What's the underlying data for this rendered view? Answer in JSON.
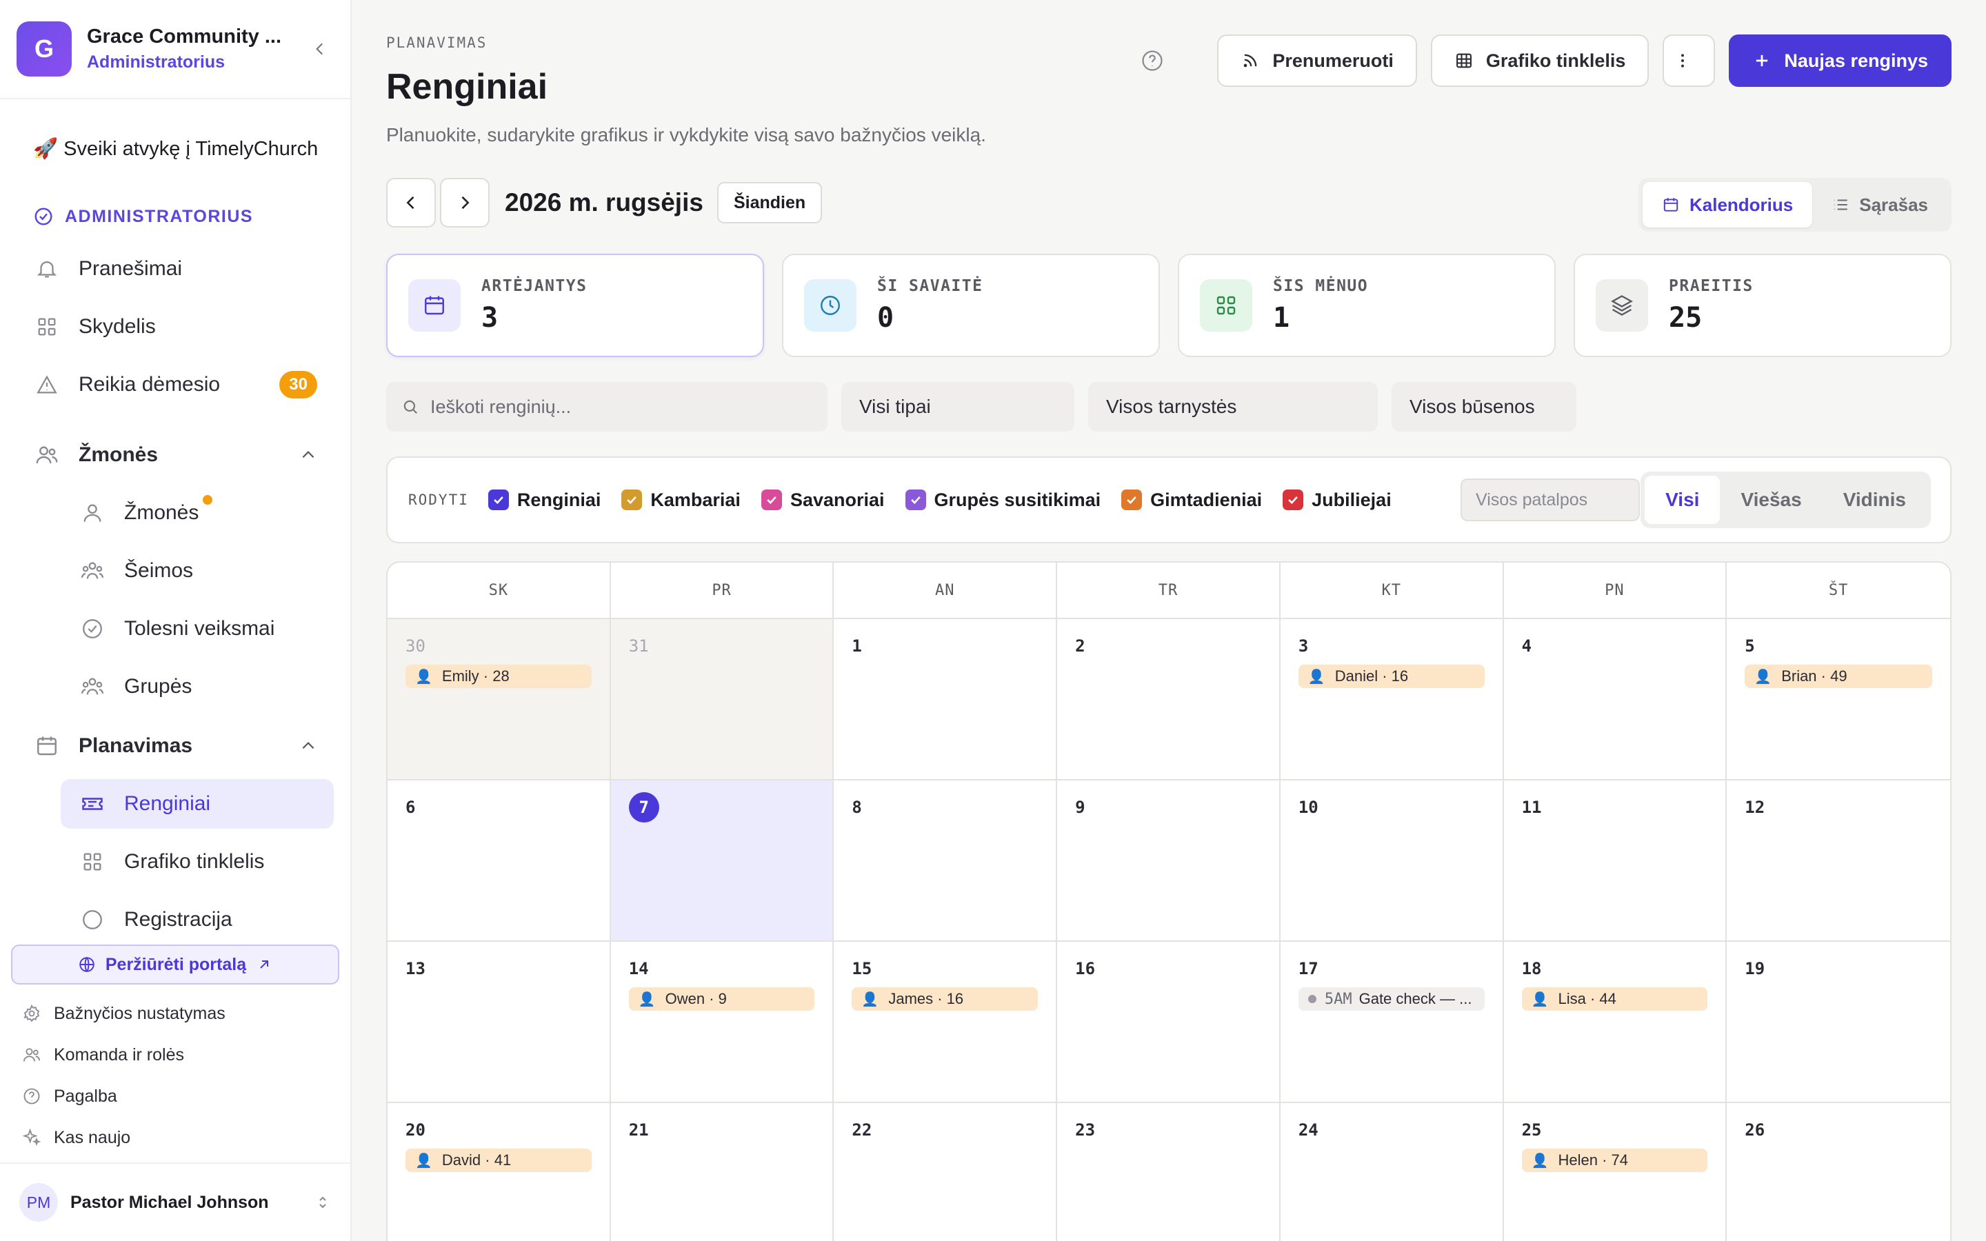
{
  "sidebar": {
    "logo_letter": "G",
    "org_name": "Grace Community ...",
    "org_role": "Administratorius",
    "welcome": "🚀 Sveiki atvykę į TimelyChurch",
    "section_admin": "ADMINISTRATORIUS",
    "items": {
      "notifications": "Pranešimai",
      "dashboard": "Skydelis",
      "attention": "Reikia dėmesio",
      "attention_badge": "30",
      "people_group": "Žmonės",
      "people": "Žmonės",
      "families": "Šeimos",
      "followups": "Tolesni veiksmai",
      "groups": "Grupės",
      "planning_group": "Planavimas",
      "events": "Renginiai",
      "schedule_grid": "Grafiko tinklelis",
      "registrations": "Registracija"
    },
    "portal_button": "Peržiūrėti portalą",
    "footer": {
      "church_settings": "Bažnyčios nustatymas",
      "team_roles": "Komanda ir rolės",
      "help": "Pagalba",
      "whats_new": "Kas naujo"
    },
    "user": {
      "initials": "PM",
      "name": "Pastor Michael Johnson"
    }
  },
  "header": {
    "breadcrumb": "PLANAVIMAS",
    "title": "Renginiai",
    "subtitle": "Planuokite, sudarykite grafikus ir vykdykite visą savo bažnyčios veiklą.",
    "subscribe": "Prenumeruoti",
    "schedule_grid": "Grafiko tinklelis",
    "new_event": "Naujas renginys"
  },
  "month_bar": {
    "label": "2026 m. rugsėjis",
    "today": "Šiandien",
    "view_calendar": "Kalendorius",
    "view_list": "Sąrašas"
  },
  "stats": [
    {
      "label": "ARTĖJANTYS",
      "value": "3",
      "icon": "calendar-icon",
      "bg": "#ecebfd",
      "fg": "#4b38d8"
    },
    {
      "label": "ŠI SAVAITĖ",
      "value": "0",
      "icon": "clock-icon",
      "bg": "#e0f2fb",
      "fg": "#1c7fb0"
    },
    {
      "label": "ŠIS MĖNUO",
      "value": "1",
      "icon": "grid-icon",
      "bg": "#e3f6e8",
      "fg": "#2c8a48"
    },
    {
      "label": "PRAEITIS",
      "value": "25",
      "icon": "layers-icon",
      "bg": "#efefed",
      "fg": "#5a5a62"
    }
  ],
  "filters": {
    "search_placeholder": "Ieškoti renginių...",
    "types": "Visi tipai",
    "ministries": "Visos tarnystės",
    "statuses": "Visos būsenos"
  },
  "show_bar": {
    "label": "RODYTI",
    "checks": [
      {
        "label": "Renginiai",
        "color": "#4b38d8"
      },
      {
        "label": "Kambariai",
        "color": "#d39a2c"
      },
      {
        "label": "Savanoriai",
        "color": "#d84a9a"
      },
      {
        "label": "Grupės susitikimai",
        "color": "#8a58d8"
      },
      {
        "label": "Gimtadieniai",
        "color": "#e0782c"
      },
      {
        "label": "Jubiliejai",
        "color": "#d8323a"
      }
    ],
    "rooms_placeholder": "Visos patalpos",
    "visibility": [
      "Visi",
      "Viešas",
      "Vidinis"
    ]
  },
  "calendar": {
    "weekdays": [
      "SK",
      "PR",
      "AN",
      "TR",
      "KT",
      "PN",
      "ŠT"
    ],
    "weeks": [
      [
        {
          "d": "30",
          "out": true,
          "events": [
            {
              "kind": "person",
              "text": "Emily · 28"
            }
          ]
        },
        {
          "d": "31",
          "out": true,
          "events": []
        },
        {
          "d": "1",
          "events": []
        },
        {
          "d": "2",
          "events": []
        },
        {
          "d": "3",
          "events": [
            {
              "kind": "person",
              "text": "Daniel · 16"
            }
          ]
        },
        {
          "d": "4",
          "events": []
        },
        {
          "d": "5",
          "events": [
            {
              "kind": "person",
              "text": "Brian · 49"
            }
          ]
        }
      ],
      [
        {
          "d": "6",
          "events": []
        },
        {
          "d": "7",
          "today": true,
          "events": []
        },
        {
          "d": "8",
          "events": []
        },
        {
          "d": "9",
          "events": []
        },
        {
          "d": "10",
          "events": []
        },
        {
          "d": "11",
          "events": []
        },
        {
          "d": "12",
          "events": []
        }
      ],
      [
        {
          "d": "13",
          "events": []
        },
        {
          "d": "14",
          "events": [
            {
              "kind": "person",
              "text": "Owen · 9"
            }
          ]
        },
        {
          "d": "15",
          "events": [
            {
              "kind": "person",
              "text": "James · 16"
            }
          ]
        },
        {
          "d": "16",
          "events": []
        },
        {
          "d": "17",
          "events": [
            {
              "kind": "event",
              "time": "5AM",
              "text": "Gate check — ..."
            }
          ]
        },
        {
          "d": "18",
          "events": [
            {
              "kind": "person",
              "text": "Lisa · 44"
            }
          ]
        },
        {
          "d": "19",
          "events": []
        }
      ],
      [
        {
          "d": "20",
          "events": [
            {
              "kind": "person",
              "text": "David · 41"
            }
          ]
        },
        {
          "d": "21",
          "events": []
        },
        {
          "d": "22",
          "events": []
        },
        {
          "d": "23",
          "events": []
        },
        {
          "d": "24",
          "events": []
        },
        {
          "d": "25",
          "events": [
            {
              "kind": "person",
              "text": "Helen · 74"
            }
          ]
        },
        {
          "d": "26",
          "events": []
        }
      ]
    ]
  }
}
